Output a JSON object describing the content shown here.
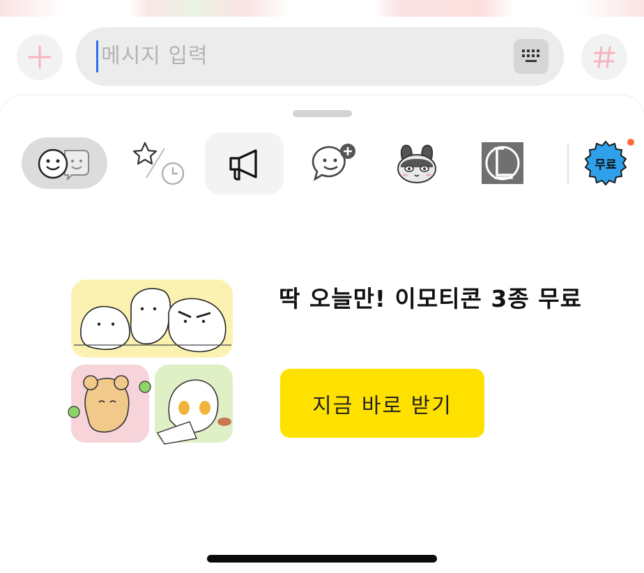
{
  "input_bar": {
    "placeholder": "메시지 입력",
    "plus_icon": "plus-icon",
    "keyboard_icon": "keyboard-icon",
    "hash_icon": "hashtag-icon"
  },
  "emoticon_tabs": [
    {
      "icon": "emoticons-icon",
      "selected": true
    },
    {
      "icon": "favorites-recent-icon",
      "selected": false
    },
    {
      "icon": "megaphone-icon",
      "selected": false
    },
    {
      "icon": "add-emoticon-icon",
      "selected": false
    },
    {
      "icon": "bunny-character-icon",
      "selected": false
    },
    {
      "icon": "league-logo-icon",
      "selected": false
    },
    {
      "icon": "free-badge-icon",
      "label": "무료",
      "has_notification": true
    }
  ],
  "promo": {
    "title": "딱 오늘만! 이모티콘 3종 무료",
    "button_label": "지금 바로 받기"
  },
  "colors": {
    "accent_yellow": "#ffe100",
    "caret_blue": "#2d6fe8",
    "free_badge": "#2fa0ea",
    "notification_dot": "#ff6a35",
    "plus_pink": "#f6b3c0"
  }
}
